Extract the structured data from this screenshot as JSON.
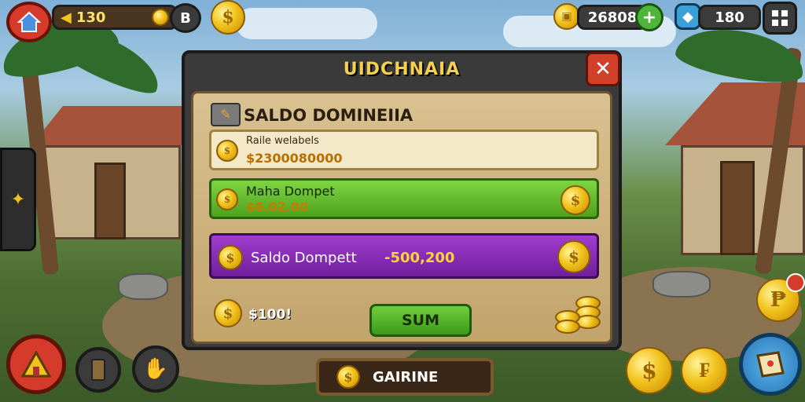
{
  "hud": {
    "coins_value": "130",
    "coin_b_label": "B",
    "gems_value": "26808",
    "energy_value": "180"
  },
  "modal": {
    "title": "UIDCHNAIA",
    "close_label": "✕",
    "panel_title": "SALDO DOMINEIIA",
    "row1": {
      "label": "Raile welabels",
      "value": "$2300080000"
    },
    "row2": {
      "label": "Maha Dompet",
      "value": "$6.02.00"
    },
    "row3": {
      "label": "Saldo Dompett",
      "value": "-500,200"
    },
    "footer_amount": "$100!",
    "sum_label": "SUM"
  },
  "bottom": {
    "main_button_label": "GAIRINE"
  },
  "colors": {
    "accent_gold": "#f1c21b",
    "green": "#6fcf3b",
    "purple": "#8c2bb8",
    "close_red": "#d2402a"
  },
  "icons": [
    "home-icon",
    "coin-icon",
    "gem-icon",
    "plus-icon",
    "menu-grid-icon",
    "star-icon",
    "tent-icon",
    "phone-icon",
    "hand-icon",
    "map-icon",
    "coin-stack-icon",
    "pencil-icon"
  ]
}
